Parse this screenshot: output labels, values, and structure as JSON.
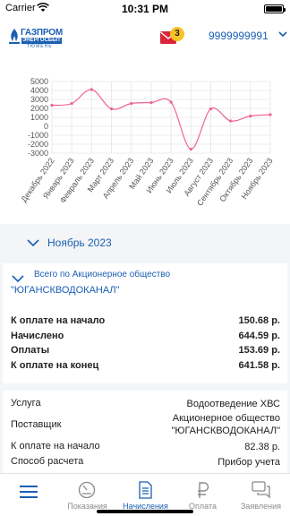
{
  "status_bar": {
    "carrier": "Carrier",
    "time": "10:31 PM"
  },
  "header": {
    "logo": {
      "name": "ГАЗПРОМ",
      "line2": "ЭНЕРГОСБЫТ",
      "line3": "ТЮМЕНЬ"
    },
    "mail_badge": "3",
    "account": "9999999991"
  },
  "chart_data": {
    "type": "line",
    "categories": [
      "Декабрь 2022",
      "Январь 2023",
      "Февраль 2023",
      "Март 2023",
      "Апрель 2023",
      "Май 2023",
      "Июнь 2023",
      "Июль 2023",
      "Август 2023",
      "Сентябрь 2023",
      "Октябрь 2023",
      "Ноябрь 2023"
    ],
    "series": [
      {
        "values": [
          2350,
          2550,
          4100,
          1950,
          2550,
          2650,
          2700,
          -2550,
          1950,
          600,
          1150,
          1300
        ]
      }
    ],
    "yticks": [
      "5000",
      "4000",
      "3000",
      "2000",
      "1000",
      "0",
      "-1000",
      "-2000",
      "-3000"
    ],
    "ylim": [
      -3000,
      5000
    ],
    "grid": true,
    "colors": {
      "line": "#f06292",
      "grid": "#e6e6e6"
    }
  },
  "month": {
    "label": "Ноябрь 2023"
  },
  "summary": {
    "title_line1": "Всего по Акционерное общество",
    "title_line2": "\"ЮГАНСКВОДОКАНАЛ\"",
    "rows": [
      {
        "label": "К оплате на начало",
        "value": "150.68 р."
      },
      {
        "label": "Начислено",
        "value": "644.59 р."
      },
      {
        "label": "Оплаты",
        "value": "153.69 р."
      },
      {
        "label": "К оплате на конец",
        "value": "641.58 р."
      }
    ]
  },
  "detail": {
    "rows": [
      {
        "label": "Услуга",
        "value": "Водоотведение ХВС"
      },
      {
        "label": "Поставщик",
        "value_line1": "Акционерное общество",
        "value_line2": "\"ЮГАНСКВОДОКАНАЛ\""
      },
      {
        "label": "К оплате на начало",
        "value": "82.38 р."
      },
      {
        "label": "Способ расчета",
        "value": "Прибор учета"
      }
    ]
  },
  "tab_bar": {
    "tabs": [
      {
        "label": ""
      },
      {
        "label": "Показания"
      },
      {
        "label": "Начисления"
      },
      {
        "label": "Оплата"
      },
      {
        "label": "Заявления"
      }
    ]
  },
  "colors": {
    "accent": "#1a5fb4",
    "badge": "#f7c325",
    "mail": "#d9263b",
    "background": "#f4f5f7"
  }
}
